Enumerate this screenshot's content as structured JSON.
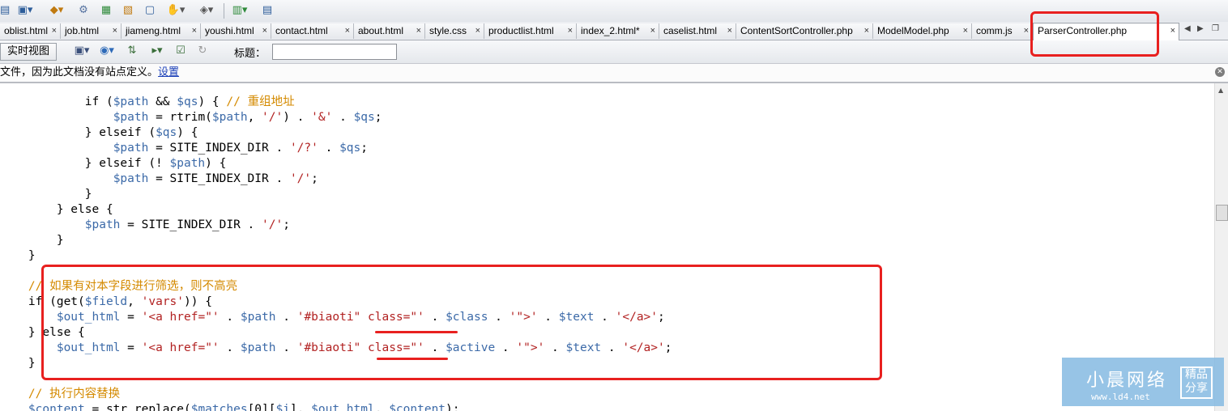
{
  "toolbar": {
    "icons": [
      "layout-icon",
      "insert-icon",
      "assets-icon",
      "gear-icon",
      "calendar-icon",
      "file-icon",
      "preview-icon",
      "hand-icon",
      "eye-icon",
      "page-icon",
      "comment-icon"
    ]
  },
  "tabs": [
    {
      "label": "oblist.html"
    },
    {
      "label": "job.html"
    },
    {
      "label": "jiameng.html"
    },
    {
      "label": "youshi.html"
    },
    {
      "label": "contact.html"
    },
    {
      "label": "about.html"
    },
    {
      "label": "style.css"
    },
    {
      "label": "productlist.html"
    },
    {
      "label": "index_2.html*"
    },
    {
      "label": "caselist.html"
    },
    {
      "label": "ContentSortController.php"
    },
    {
      "label": "ModelModel.php"
    },
    {
      "label": "comm.js"
    },
    {
      "label": "ParserController.php"
    }
  ],
  "tab_close": "×",
  "toolbar2": {
    "realtime_view": "实时视图",
    "title_label": "标题：",
    "title_value": ""
  },
  "infobar": {
    "message": "文件，因为此文档没有站点定义。",
    "link": "设置"
  },
  "code_lines": [
    [
      {
        "t": "            if (",
        "c": "k"
      },
      {
        "t": "$path",
        "c": "v"
      },
      {
        "t": " && ",
        "c": "k"
      },
      {
        "t": "$qs",
        "c": "v"
      },
      {
        "t": ") { ",
        "c": "k"
      },
      {
        "t": "// 重组地址",
        "c": "c"
      }
    ],
    [
      {
        "t": "                ",
        "c": "k"
      },
      {
        "t": "$path",
        "c": "v"
      },
      {
        "t": " = rtrim(",
        "c": "k"
      },
      {
        "t": "$path",
        "c": "v"
      },
      {
        "t": ", ",
        "c": "k"
      },
      {
        "t": "'/'",
        "c": "s"
      },
      {
        "t": ") . ",
        "c": "k"
      },
      {
        "t": "'&'",
        "c": "s"
      },
      {
        "t": " . ",
        "c": "k"
      },
      {
        "t": "$qs",
        "c": "v"
      },
      {
        "t": ";",
        "c": "k"
      }
    ],
    [
      {
        "t": "            } elseif (",
        "c": "k"
      },
      {
        "t": "$qs",
        "c": "v"
      },
      {
        "t": ") {",
        "c": "k"
      }
    ],
    [
      {
        "t": "                ",
        "c": "k"
      },
      {
        "t": "$path",
        "c": "v"
      },
      {
        "t": " = SITE_INDEX_DIR . ",
        "c": "k"
      },
      {
        "t": "'/?'",
        "c": "s"
      },
      {
        "t": " . ",
        "c": "k"
      },
      {
        "t": "$qs",
        "c": "v"
      },
      {
        "t": ";",
        "c": "k"
      }
    ],
    [
      {
        "t": "            } elseif (! ",
        "c": "k"
      },
      {
        "t": "$path",
        "c": "v"
      },
      {
        "t": ") {",
        "c": "k"
      }
    ],
    [
      {
        "t": "                ",
        "c": "k"
      },
      {
        "t": "$path",
        "c": "v"
      },
      {
        "t": " = SITE_INDEX_DIR . ",
        "c": "k"
      },
      {
        "t": "'/'",
        "c": "s"
      },
      {
        "t": ";",
        "c": "k"
      }
    ],
    [
      {
        "t": "            }",
        "c": "k"
      }
    ],
    [
      {
        "t": "        } else {",
        "c": "k"
      }
    ],
    [
      {
        "t": "            ",
        "c": "k"
      },
      {
        "t": "$path",
        "c": "v"
      },
      {
        "t": " = SITE_INDEX_DIR . ",
        "c": "k"
      },
      {
        "t": "'/'",
        "c": "s"
      },
      {
        "t": ";",
        "c": "k"
      }
    ],
    [
      {
        "t": "        }",
        "c": "k"
      }
    ],
    [
      {
        "t": "    }",
        "c": "k"
      }
    ],
    [
      {
        "t": "",
        "c": "k"
      }
    ],
    [
      {
        "t": "    ",
        "c": "k"
      },
      {
        "t": "// 如果有对本字段进行筛选，则不高亮",
        "c": "c"
      }
    ],
    [
      {
        "t": "    if (get(",
        "c": "k"
      },
      {
        "t": "$field",
        "c": "v"
      },
      {
        "t": ", ",
        "c": "k"
      },
      {
        "t": "'vars'",
        "c": "s"
      },
      {
        "t": ")) {",
        "c": "k"
      }
    ],
    [
      {
        "t": "        ",
        "c": "k"
      },
      {
        "t": "$out_html",
        "c": "v"
      },
      {
        "t": " = ",
        "c": "k"
      },
      {
        "t": "'<a href=\"'",
        "c": "s"
      },
      {
        "t": " . ",
        "c": "k"
      },
      {
        "t": "$path",
        "c": "v"
      },
      {
        "t": " . ",
        "c": "k"
      },
      {
        "t": "'#biaoti\" class=\"'",
        "c": "s"
      },
      {
        "t": " . ",
        "c": "k"
      },
      {
        "t": "$class",
        "c": "v"
      },
      {
        "t": " . ",
        "c": "k"
      },
      {
        "t": "'\">'",
        "c": "s"
      },
      {
        "t": " . ",
        "c": "k"
      },
      {
        "t": "$text",
        "c": "v"
      },
      {
        "t": " . ",
        "c": "k"
      },
      {
        "t": "'</a>'",
        "c": "s"
      },
      {
        "t": ";",
        "c": "k"
      }
    ],
    [
      {
        "t": "    } else {",
        "c": "k"
      }
    ],
    [
      {
        "t": "        ",
        "c": "k"
      },
      {
        "t": "$out_html",
        "c": "v"
      },
      {
        "t": " = ",
        "c": "k"
      },
      {
        "t": "'<a href=\"'",
        "c": "s"
      },
      {
        "t": " . ",
        "c": "k"
      },
      {
        "t": "$path",
        "c": "v"
      },
      {
        "t": " . ",
        "c": "k"
      },
      {
        "t": "'#biaoti\" class=\"'",
        "c": "s"
      },
      {
        "t": " . ",
        "c": "k"
      },
      {
        "t": "$active",
        "c": "v"
      },
      {
        "t": " . ",
        "c": "k"
      },
      {
        "t": "'\">'",
        "c": "s"
      },
      {
        "t": " . ",
        "c": "k"
      },
      {
        "t": "$text",
        "c": "v"
      },
      {
        "t": " . ",
        "c": "k"
      },
      {
        "t": "'</a>'",
        "c": "s"
      },
      {
        "t": ";",
        "c": "k"
      }
    ],
    [
      {
        "t": "    }",
        "c": "k"
      }
    ],
    [
      {
        "t": "",
        "c": "k"
      }
    ],
    [
      {
        "t": "    ",
        "c": "k"
      },
      {
        "t": "// 执行内容替换",
        "c": "c"
      }
    ],
    [
      {
        "t": "    ",
        "c": "k"
      },
      {
        "t": "$content",
        "c": "v"
      },
      {
        "t": " = str_replace(",
        "c": "k"
      },
      {
        "t": "$matches",
        "c": "v"
      },
      {
        "t": "[0][",
        "c": "k"
      },
      {
        "t": "$i",
        "c": "v"
      },
      {
        "t": "], ",
        "c": "k"
      },
      {
        "t": "$out_html",
        "c": "v"
      },
      {
        "t": ", ",
        "c": "k"
      },
      {
        "t": "$content",
        "c": "v"
      },
      {
        "t": ");",
        "c": "k"
      }
    ]
  ],
  "watermark": {
    "brand": "小晨网络",
    "url": "www.ld4.net",
    "badge_line1": "精品",
    "badge_line2": "分享"
  }
}
